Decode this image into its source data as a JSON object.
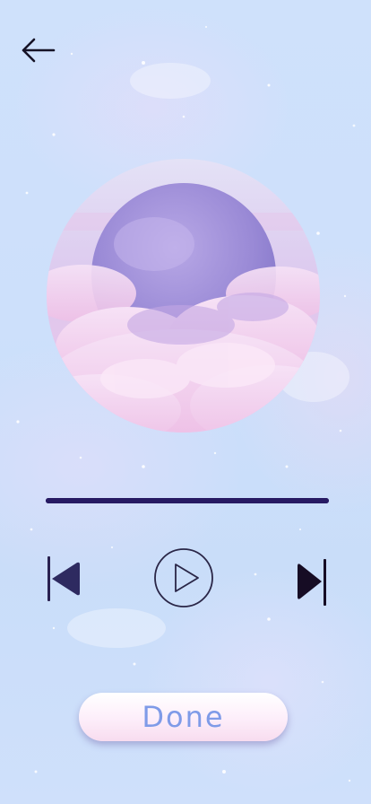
{
  "header": {
    "back_icon": "arrow-left-icon"
  },
  "artwork": {
    "description_icon": "cloud-sphere-artwork"
  },
  "player": {
    "progress": 1.0,
    "prev_icon": "skip-previous-icon",
    "play_icon": "play-icon",
    "next_icon": "skip-next-icon"
  },
  "footer": {
    "done_label": "Done"
  },
  "colors": {
    "background": "#cde0fb",
    "track": "#271a63",
    "controls": "#1e1848",
    "done_text": "#7f9be8",
    "done_bg": "#fdeefa"
  }
}
